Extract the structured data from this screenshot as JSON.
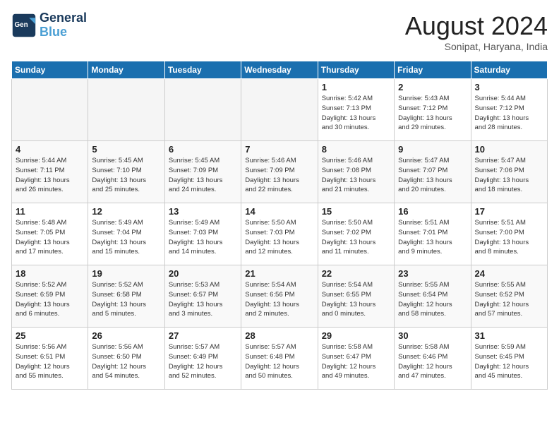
{
  "header": {
    "logo_line1": "General",
    "logo_line2": "Blue",
    "month_year": "August 2024",
    "location": "Sonipat, Haryana, India"
  },
  "weekdays": [
    "Sunday",
    "Monday",
    "Tuesday",
    "Wednesday",
    "Thursday",
    "Friday",
    "Saturday"
  ],
  "weeks": [
    [
      {
        "day": "",
        "info": ""
      },
      {
        "day": "",
        "info": ""
      },
      {
        "day": "",
        "info": ""
      },
      {
        "day": "",
        "info": ""
      },
      {
        "day": "1",
        "info": "Sunrise: 5:42 AM\nSunset: 7:13 PM\nDaylight: 13 hours\nand 30 minutes."
      },
      {
        "day": "2",
        "info": "Sunrise: 5:43 AM\nSunset: 7:12 PM\nDaylight: 13 hours\nand 29 minutes."
      },
      {
        "day": "3",
        "info": "Sunrise: 5:44 AM\nSunset: 7:12 PM\nDaylight: 13 hours\nand 28 minutes."
      }
    ],
    [
      {
        "day": "4",
        "info": "Sunrise: 5:44 AM\nSunset: 7:11 PM\nDaylight: 13 hours\nand 26 minutes."
      },
      {
        "day": "5",
        "info": "Sunrise: 5:45 AM\nSunset: 7:10 PM\nDaylight: 13 hours\nand 25 minutes."
      },
      {
        "day": "6",
        "info": "Sunrise: 5:45 AM\nSunset: 7:09 PM\nDaylight: 13 hours\nand 24 minutes."
      },
      {
        "day": "7",
        "info": "Sunrise: 5:46 AM\nSunset: 7:09 PM\nDaylight: 13 hours\nand 22 minutes."
      },
      {
        "day": "8",
        "info": "Sunrise: 5:46 AM\nSunset: 7:08 PM\nDaylight: 13 hours\nand 21 minutes."
      },
      {
        "day": "9",
        "info": "Sunrise: 5:47 AM\nSunset: 7:07 PM\nDaylight: 13 hours\nand 20 minutes."
      },
      {
        "day": "10",
        "info": "Sunrise: 5:47 AM\nSunset: 7:06 PM\nDaylight: 13 hours\nand 18 minutes."
      }
    ],
    [
      {
        "day": "11",
        "info": "Sunrise: 5:48 AM\nSunset: 7:05 PM\nDaylight: 13 hours\nand 17 minutes."
      },
      {
        "day": "12",
        "info": "Sunrise: 5:49 AM\nSunset: 7:04 PM\nDaylight: 13 hours\nand 15 minutes."
      },
      {
        "day": "13",
        "info": "Sunrise: 5:49 AM\nSunset: 7:03 PM\nDaylight: 13 hours\nand 14 minutes."
      },
      {
        "day": "14",
        "info": "Sunrise: 5:50 AM\nSunset: 7:03 PM\nDaylight: 13 hours\nand 12 minutes."
      },
      {
        "day": "15",
        "info": "Sunrise: 5:50 AM\nSunset: 7:02 PM\nDaylight: 13 hours\nand 11 minutes."
      },
      {
        "day": "16",
        "info": "Sunrise: 5:51 AM\nSunset: 7:01 PM\nDaylight: 13 hours\nand 9 minutes."
      },
      {
        "day": "17",
        "info": "Sunrise: 5:51 AM\nSunset: 7:00 PM\nDaylight: 13 hours\nand 8 minutes."
      }
    ],
    [
      {
        "day": "18",
        "info": "Sunrise: 5:52 AM\nSunset: 6:59 PM\nDaylight: 13 hours\nand 6 minutes."
      },
      {
        "day": "19",
        "info": "Sunrise: 5:52 AM\nSunset: 6:58 PM\nDaylight: 13 hours\nand 5 minutes."
      },
      {
        "day": "20",
        "info": "Sunrise: 5:53 AM\nSunset: 6:57 PM\nDaylight: 13 hours\nand 3 minutes."
      },
      {
        "day": "21",
        "info": "Sunrise: 5:54 AM\nSunset: 6:56 PM\nDaylight: 13 hours\nand 2 minutes."
      },
      {
        "day": "22",
        "info": "Sunrise: 5:54 AM\nSunset: 6:55 PM\nDaylight: 13 hours\nand 0 minutes."
      },
      {
        "day": "23",
        "info": "Sunrise: 5:55 AM\nSunset: 6:54 PM\nDaylight: 12 hours\nand 58 minutes."
      },
      {
        "day": "24",
        "info": "Sunrise: 5:55 AM\nSunset: 6:52 PM\nDaylight: 12 hours\nand 57 minutes."
      }
    ],
    [
      {
        "day": "25",
        "info": "Sunrise: 5:56 AM\nSunset: 6:51 PM\nDaylight: 12 hours\nand 55 minutes."
      },
      {
        "day": "26",
        "info": "Sunrise: 5:56 AM\nSunset: 6:50 PM\nDaylight: 12 hours\nand 54 minutes."
      },
      {
        "day": "27",
        "info": "Sunrise: 5:57 AM\nSunset: 6:49 PM\nDaylight: 12 hours\nand 52 minutes."
      },
      {
        "day": "28",
        "info": "Sunrise: 5:57 AM\nSunset: 6:48 PM\nDaylight: 12 hours\nand 50 minutes."
      },
      {
        "day": "29",
        "info": "Sunrise: 5:58 AM\nSunset: 6:47 PM\nDaylight: 12 hours\nand 49 minutes."
      },
      {
        "day": "30",
        "info": "Sunrise: 5:58 AM\nSunset: 6:46 PM\nDaylight: 12 hours\nand 47 minutes."
      },
      {
        "day": "31",
        "info": "Sunrise: 5:59 AM\nSunset: 6:45 PM\nDaylight: 12 hours\nand 45 minutes."
      }
    ]
  ]
}
